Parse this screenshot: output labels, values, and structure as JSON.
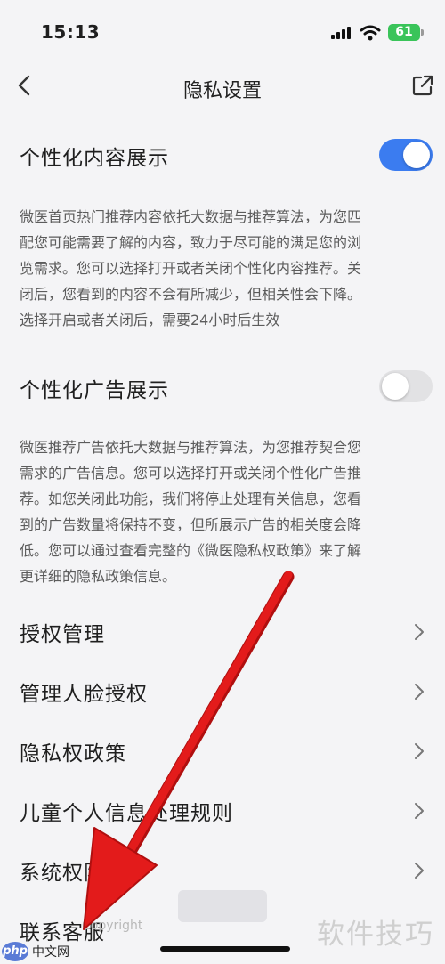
{
  "status_bar": {
    "time": "15:13",
    "battery": "61"
  },
  "nav": {
    "title": "隐私设置"
  },
  "settings": [
    {
      "title": "个性化内容展示",
      "enabled": true,
      "desc_lines": [
        "微医首页热门推荐内容依托大数据与推荐算法，为您匹",
        "配您可能需要了解的内容，致力于尽可能的满足您的浏",
        "览需求。您可以选择打开或者关闭个性化内容推荐。关",
        "闭后，您看到的内容不会有所减少，但相关性会下降。",
        "选择开启或者关闭后，需要24小时后生效"
      ]
    },
    {
      "title": "个性化广告展示",
      "enabled": false,
      "desc_lines": [
        "微医推荐广告依托大数据与推荐算法，为您推荐契合您",
        "需求的广告信息。您可以选择打开或关闭个性化广告推",
        "荐。如您关闭此功能，我们将停止处理有关信息，您看",
        "到的广告数量将保持不变，但所展示广告的相关度会降",
        "低。您可以通过查看完整的《微医隐私权政策》来了解",
        "更详细的隐私政策信息。"
      ]
    }
  ],
  "menu": [
    {
      "label": "授权管理"
    },
    {
      "label": "管理人脸授权"
    },
    {
      "label": "隐私权政策"
    },
    {
      "label": "儿童个人信息处理规则"
    },
    {
      "label": "系统权限"
    },
    {
      "label": "联系客服"
    }
  ],
  "colors": {
    "toggle_on": "#3b7cf0",
    "toggle_off": "#e2e2e4",
    "annotation_arrow": "#e31b1b"
  },
  "watermarks": {
    "copyright": "Copyright",
    "right": "软件技巧",
    "logo_mark": "php",
    "logo_text": "中文网"
  }
}
